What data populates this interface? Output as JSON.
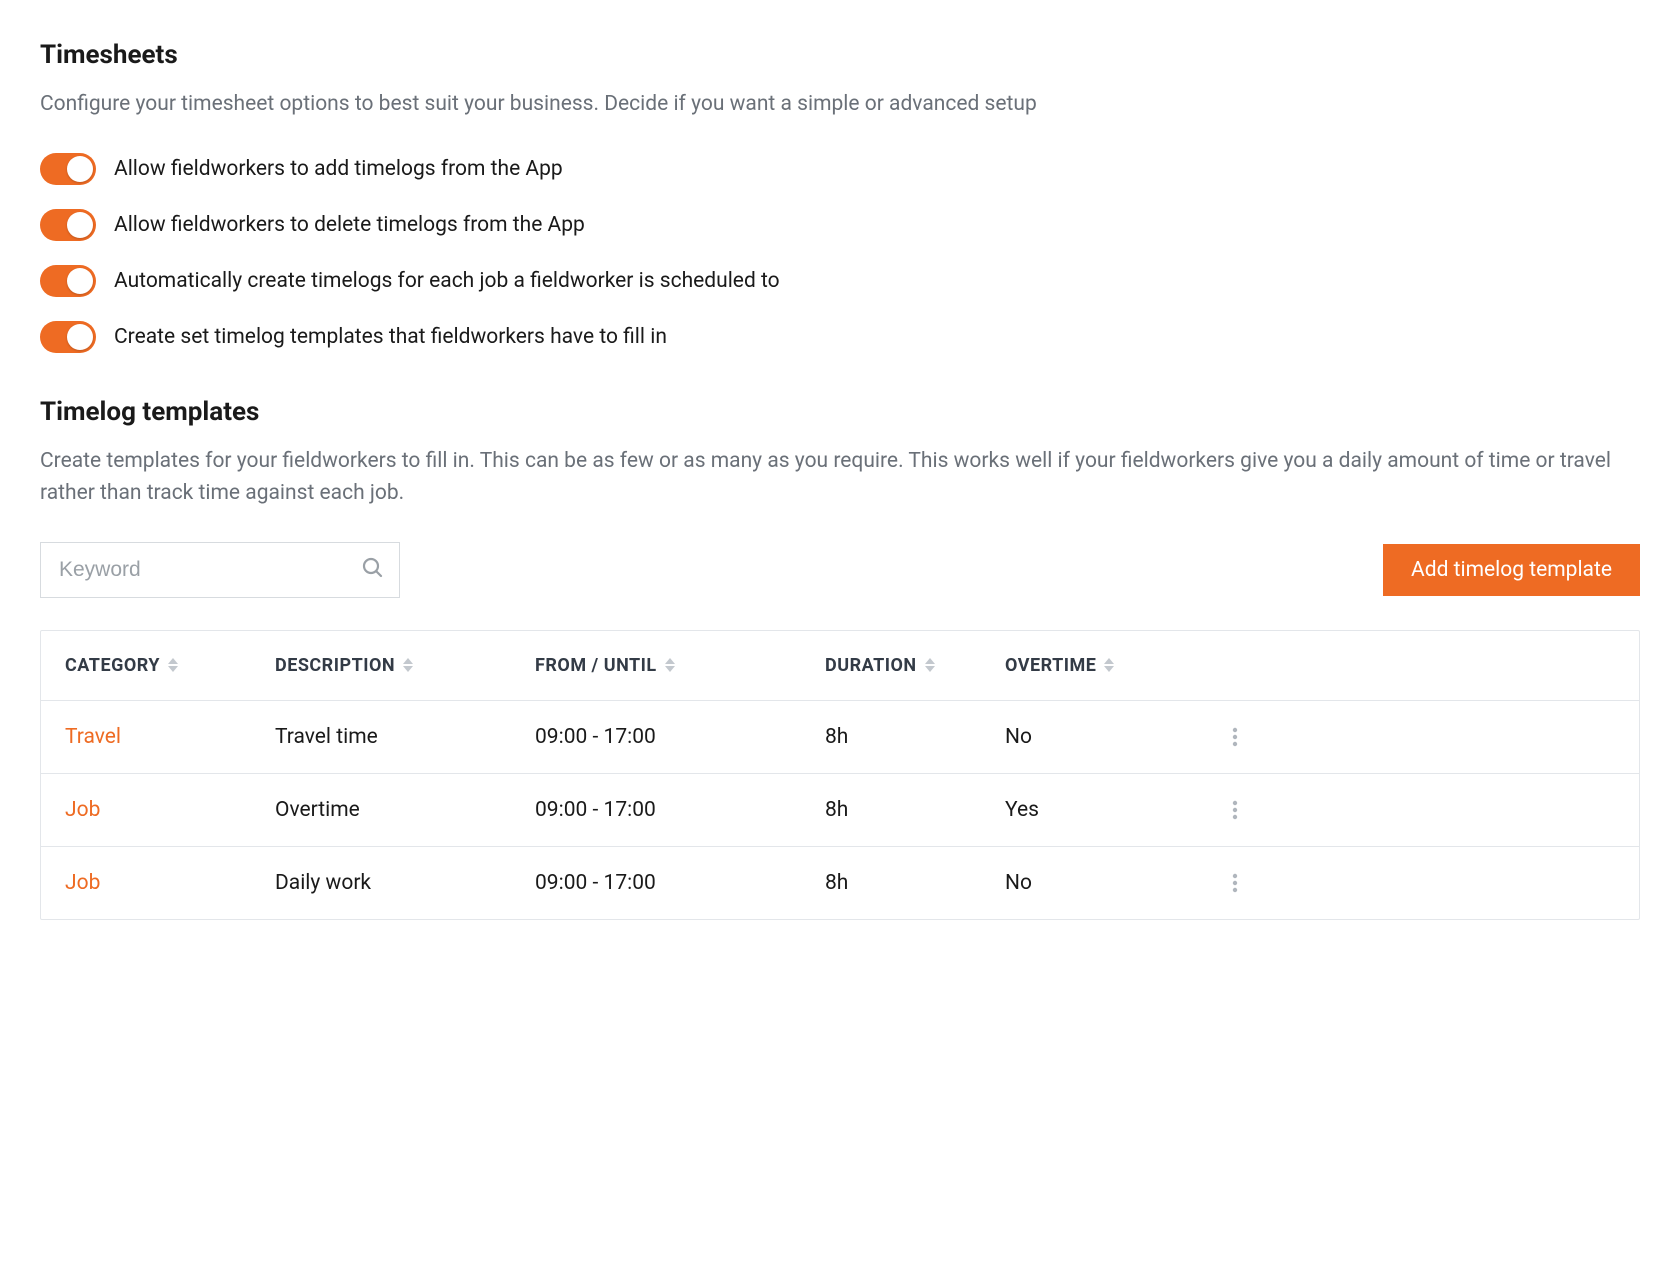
{
  "timesheets": {
    "title": "Timesheets",
    "desc": "Configure your timesheet options to best suit your business. Decide if you want a simple or advanced setup",
    "toggles": [
      {
        "label": "Allow fieldworkers to add timelogs from the App",
        "on": true
      },
      {
        "label": "Allow fieldworkers to delete timelogs from the App",
        "on": true
      },
      {
        "label": "Automatically create timelogs for each job a fieldworker is scheduled to",
        "on": true
      },
      {
        "label": "Create set timelog templates that fieldworkers have to fill in",
        "on": true
      }
    ]
  },
  "templates": {
    "title": "Timelog templates",
    "desc": "Create templates for your fieldworkers to fill in. This can be as few or as many as you require. This works well if your fieldworkers give you a daily amount of time or travel rather than track time against each job.",
    "search_placeholder": "Keyword",
    "add_button": "Add timelog template",
    "columns": {
      "category": "CATEGORY",
      "description": "DESCRIPTION",
      "from_until": "FROM / UNTIL",
      "duration": "DURATION",
      "overtime": "OVERTIME"
    },
    "rows": [
      {
        "category": "Travel",
        "description": "Travel time",
        "from_until": "09:00 - 17:00",
        "duration": "8h",
        "overtime": "No"
      },
      {
        "category": "Job",
        "description": "Overtime",
        "from_until": "09:00 - 17:00",
        "duration": "8h",
        "overtime": "Yes"
      },
      {
        "category": "Job",
        "description": "Daily work",
        "from_until": "09:00 - 17:00",
        "duration": "8h",
        "overtime": "No"
      }
    ]
  }
}
